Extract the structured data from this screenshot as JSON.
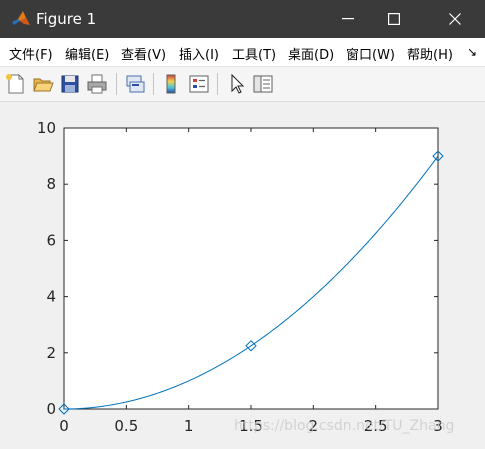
{
  "window": {
    "title": "Figure 1",
    "controls": {
      "minimize": "minimize",
      "maximize": "maximize",
      "close": "close"
    }
  },
  "menubar": {
    "items": [
      {
        "label": "文件(F)"
      },
      {
        "label": "编辑(E)"
      },
      {
        "label": "查看(V)"
      },
      {
        "label": "插入(I)"
      },
      {
        "label": "工具(T)"
      },
      {
        "label": "桌面(D)"
      },
      {
        "label": "窗口(W)"
      },
      {
        "label": "帮助(H)"
      }
    ],
    "overflow_icon": "double-chevron-icon"
  },
  "toolbar": {
    "buttons": [
      "new-figure-icon",
      "open-file-icon",
      "save-icon",
      "print-icon",
      "link-plot-icon",
      "insert-colorbar-icon",
      "insert-legend-icon",
      "edit-plot-cursor-icon",
      "property-inspector-icon"
    ]
  },
  "watermark": "https://blog.csdn.net/TU_Zhang",
  "colors": {
    "title_bar": "#3a3a3a",
    "line": "#0072bd",
    "axes_bg": "#ffffff",
    "figure_bg": "#f0f0f0"
  },
  "chart_data": {
    "type": "line",
    "title": "",
    "xlabel": "",
    "ylabel": "",
    "xlim": [
      0,
      3
    ],
    "ylim": [
      0,
      10
    ],
    "xticks": [
      "0",
      "0.5",
      "1",
      "1.5",
      "2",
      "2.5",
      "3"
    ],
    "yticks": [
      "0",
      "2",
      "4",
      "6",
      "8",
      "10"
    ],
    "grid": false,
    "series": [
      {
        "marker": "diamond",
        "points": [
          [
            0,
            0
          ],
          [
            1.5,
            2.25
          ],
          [
            3,
            9
          ]
        ],
        "curve": "y = x^2"
      }
    ]
  }
}
